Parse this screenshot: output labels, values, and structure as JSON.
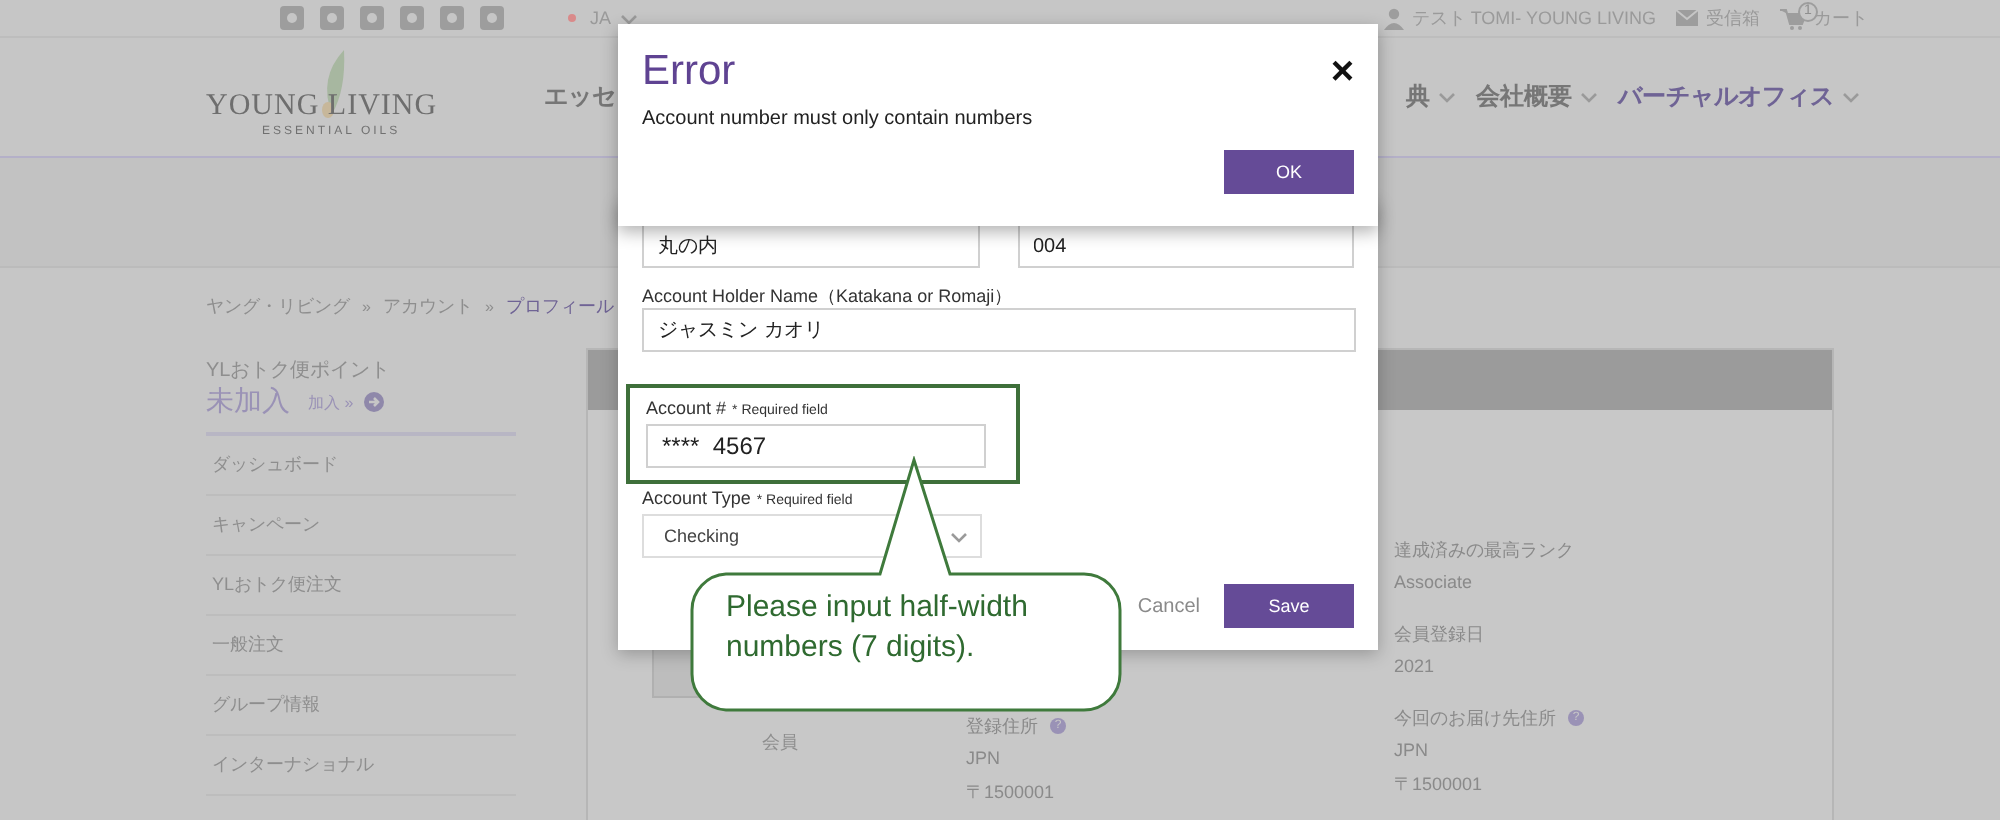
{
  "top_bar": {
    "language": "JA",
    "user": "テスト TOMI- YOUNG LIVING",
    "inbox": "受信箱",
    "cart_count": "1",
    "cart": "カート"
  },
  "header": {
    "logo_name": "YOUNG LIVING",
    "logo_tagline": "ESSENTIAL OILS",
    "nav": [
      {
        "label": "エッセ",
        "selected": false,
        "menu": false
      },
      {
        "label": "典",
        "selected": false,
        "menu": true
      },
      {
        "label": "会社概要",
        "selected": false,
        "menu": true
      },
      {
        "label": "バーチャルオフィス",
        "selected": true,
        "menu": true
      }
    ]
  },
  "breadcrumb": {
    "separator": "»",
    "items": [
      {
        "label": "ヤング・リビング",
        "selected": false
      },
      {
        "label": "アカウント",
        "selected": false
      },
      {
        "label": "プロフィール",
        "selected": true
      }
    ]
  },
  "sidebar": {
    "points_title": "YLおトク便ポイント",
    "points_status": "未加入",
    "join_link": "加入 »",
    "items": [
      {
        "label": "ダッシュボード",
        "selected": false
      },
      {
        "label": "キャンペーン",
        "selected": false
      },
      {
        "label": "YLおトク便注文",
        "selected": false
      },
      {
        "label": "一般注文",
        "selected": false
      },
      {
        "label": "グループ情報",
        "selected": false
      },
      {
        "label": "インターナショナル",
        "selected": false
      }
    ]
  },
  "profile": {
    "member_label": "会員",
    "columns": [
      {
        "fields": [
          {
            "label": "登録住所",
            "help": "?",
            "lines": [
              "JPN",
              "〒1500001"
            ]
          }
        ]
      },
      {
        "fields": [
          {
            "label": "達成済みの最高ランク",
            "lines": [
              "Associate"
            ]
          },
          {
            "label": "会員登録日",
            "lines": [
              "2021"
            ]
          },
          {
            "label": "今回のお届け先住所",
            "help": "?",
            "lines": [
              "JPN",
              "〒1500001"
            ]
          }
        ]
      }
    ]
  },
  "form_modal": {
    "top_fields": [
      "丸の内",
      "004"
    ],
    "holder": {
      "label": "Account Holder Name（Katakana or Romaji）",
      "value": "ジャスミン カオリ"
    },
    "account": {
      "label": "Account #",
      "note": "* Required field",
      "value": "****  4567",
      "highlighted": true
    },
    "type": {
      "label": "Account Type",
      "note": "* Required field",
      "value": "Checking"
    },
    "cancel": "Cancel",
    "save": "Save"
  },
  "error_dialog": {
    "title": "Error",
    "close": "×",
    "message": "Account number must only contain numbers",
    "ok": "OK"
  },
  "callout": {
    "text": "Please input half-width numbers (7 digits)."
  }
}
